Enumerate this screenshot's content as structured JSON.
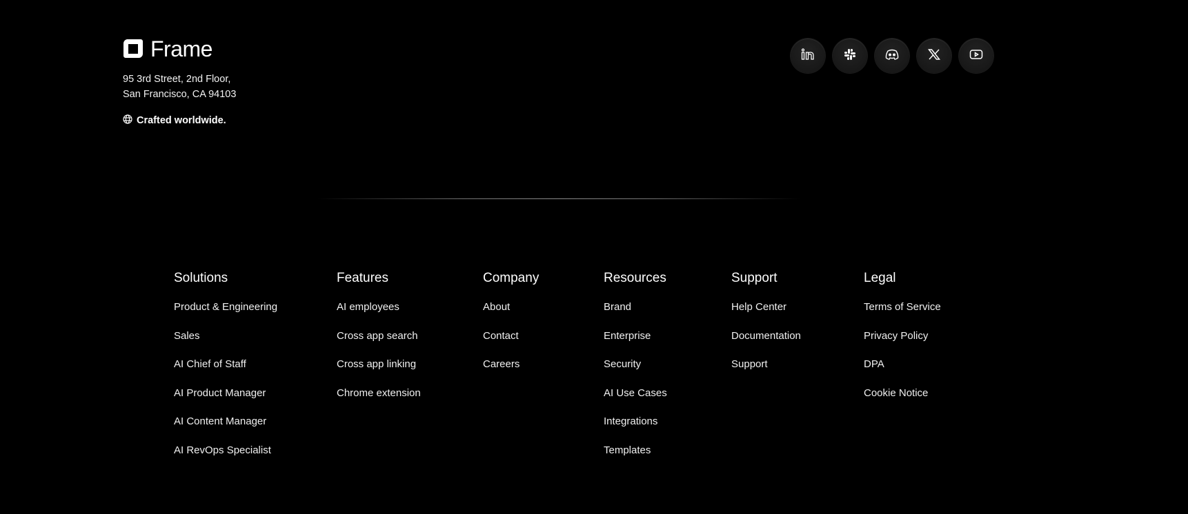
{
  "brand": {
    "name": "Frame",
    "address_line1": "95 3rd Street, 2nd Floor,",
    "address_line2": "San Francisco, CA 94103",
    "tagline": "Crafted worldwide.",
    "tagline_icon": "globe-icon"
  },
  "socials": [
    {
      "name": "LinkedIn",
      "icon": "linkedin-icon"
    },
    {
      "name": "Slack",
      "icon": "slack-icon"
    },
    {
      "name": "Discord",
      "icon": "discord-icon"
    },
    {
      "name": "X",
      "icon": "x-icon"
    },
    {
      "name": "YouTube",
      "icon": "youtube-icon"
    }
  ],
  "columns": [
    {
      "title": "Solutions",
      "items": [
        "Product & Engineering",
        "Sales",
        "AI  Chief of Staff",
        "AI  Product Manager",
        "AI  Content Manager",
        "AI  RevOps Specialist"
      ]
    },
    {
      "title": "Features",
      "items": [
        "AI employees",
        "Cross app search",
        "Cross app linking",
        "Chrome extension"
      ]
    },
    {
      "title": "Company",
      "items": [
        "About",
        "Contact",
        "Careers"
      ]
    },
    {
      "title": "Resources",
      "items": [
        "Brand",
        "Enterprise",
        "Security",
        "AI Use Cases",
        "Integrations",
        "Templates"
      ]
    },
    {
      "title": "Support",
      "items": [
        "Help Center",
        "Documentation",
        "Support"
      ]
    },
    {
      "title": "Legal",
      "items": [
        "Terms of Service",
        "Privacy Policy",
        "DPA",
        "Cookie Notice"
      ]
    }
  ],
  "colors": {
    "background": "#000000",
    "text": "#ffffff",
    "social_bg": "#1a1a1a"
  }
}
